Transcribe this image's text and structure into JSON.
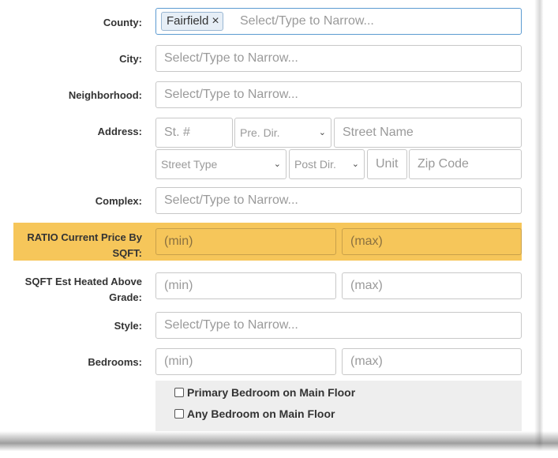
{
  "form": {
    "county": {
      "label": "County:",
      "tag": "Fairfield",
      "tag_remove": "×",
      "placeholder": "Select/Type to Narrow..."
    },
    "city": {
      "label": "City:",
      "placeholder": "Select/Type to Narrow..."
    },
    "neighborhood": {
      "label": "Neighborhood:",
      "placeholder": "Select/Type to Narrow..."
    },
    "address": {
      "label": "Address:",
      "street_number_placeholder": "St. #",
      "pre_dir_value": "Pre. Dir.",
      "street_name_placeholder": "Street Name",
      "street_type_value": "Street Type",
      "post_dir_value": "Post Dir.",
      "unit_placeholder": "Unit",
      "zip_placeholder": "Zip Code"
    },
    "complex": {
      "label": "Complex:",
      "placeholder": "Select/Type to Narrow..."
    },
    "ratio_price_sqft": {
      "label_line1": "RATIO Current Price By",
      "label_line2": "SQFT:",
      "min_placeholder": "(min)",
      "max_placeholder": "(max)",
      "highlight_color": "#f6c65a"
    },
    "sqft_heated": {
      "label_line1": "SQFT Est Heated Above",
      "label_line2": "Grade:",
      "min_placeholder": "(min)",
      "max_placeholder": "(max)"
    },
    "style": {
      "label": "Style:",
      "placeholder": "Select/Type to Narrow..."
    },
    "bedrooms": {
      "label": "Bedrooms:",
      "min_placeholder": "(min)",
      "max_placeholder": "(max)",
      "options": [
        {
          "label": "Primary Bedroom on Main Floor",
          "checked": false
        },
        {
          "label": "Any Bedroom on Main Floor",
          "checked": false
        }
      ]
    }
  }
}
